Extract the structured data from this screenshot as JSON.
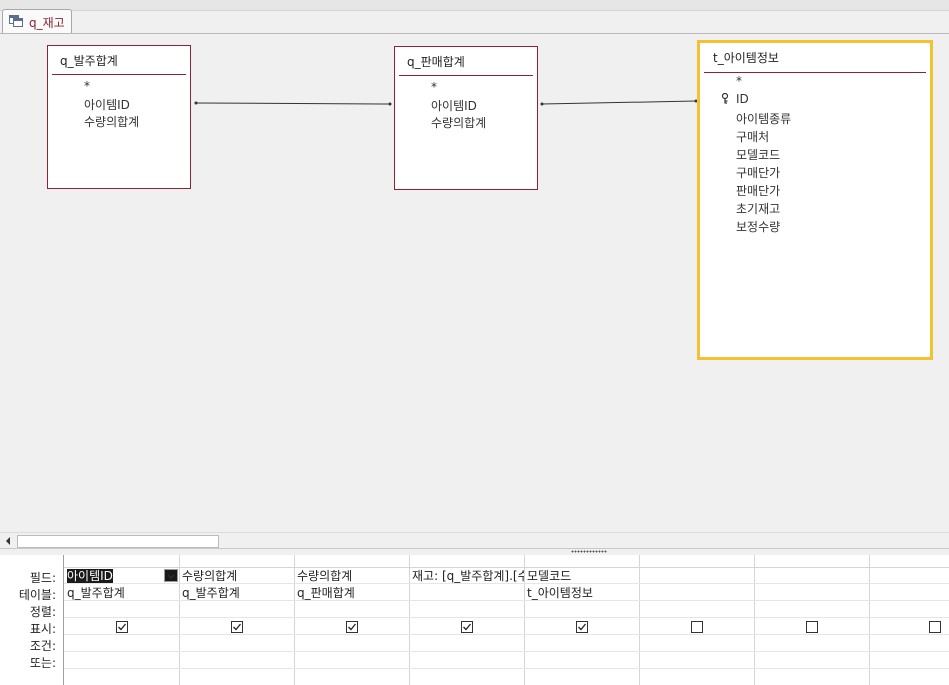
{
  "tab": {
    "title": "q_재고",
    "icon": "query-icon"
  },
  "tables": [
    {
      "name": "q_발주합계",
      "fields": [
        "*",
        "아이템ID",
        "수량의합계"
      ]
    },
    {
      "name": "q_판매합계",
      "fields": [
        "*",
        "아이템ID",
        "수량의합계"
      ]
    },
    {
      "name": "t_아이템정보",
      "fields": [
        "*",
        "ID",
        "아이템종류",
        "구매처",
        "모델코드",
        "구매단가",
        "판매단가",
        "초기재고",
        "보정수량"
      ],
      "primary_key": "ID"
    }
  ],
  "grid": {
    "row_labels": [
      "필드:",
      "테이블:",
      "정렬:",
      "표시:",
      "조건:",
      "또는:"
    ],
    "columns": [
      {
        "field": "아이템ID",
        "table": "q_발주합계",
        "show": true
      },
      {
        "field": "수량의합계",
        "table": "q_발주합계",
        "show": true
      },
      {
        "field": "수량의합계",
        "table": "q_판매합계",
        "show": true
      },
      {
        "field": "재고: [q_발주합계].[수",
        "table": "",
        "show": true
      },
      {
        "field": "모델코드",
        "table": "t_아이템정보",
        "show": true
      },
      {
        "field": "",
        "table": "",
        "show": false
      },
      {
        "field": "",
        "table": "",
        "show": false
      },
      {
        "field": "",
        "table": "",
        "show": false
      }
    ]
  },
  "colors": {
    "table_border": "#8b2333",
    "selected_border": "#f2c230",
    "tab_text": "#8a2434"
  }
}
